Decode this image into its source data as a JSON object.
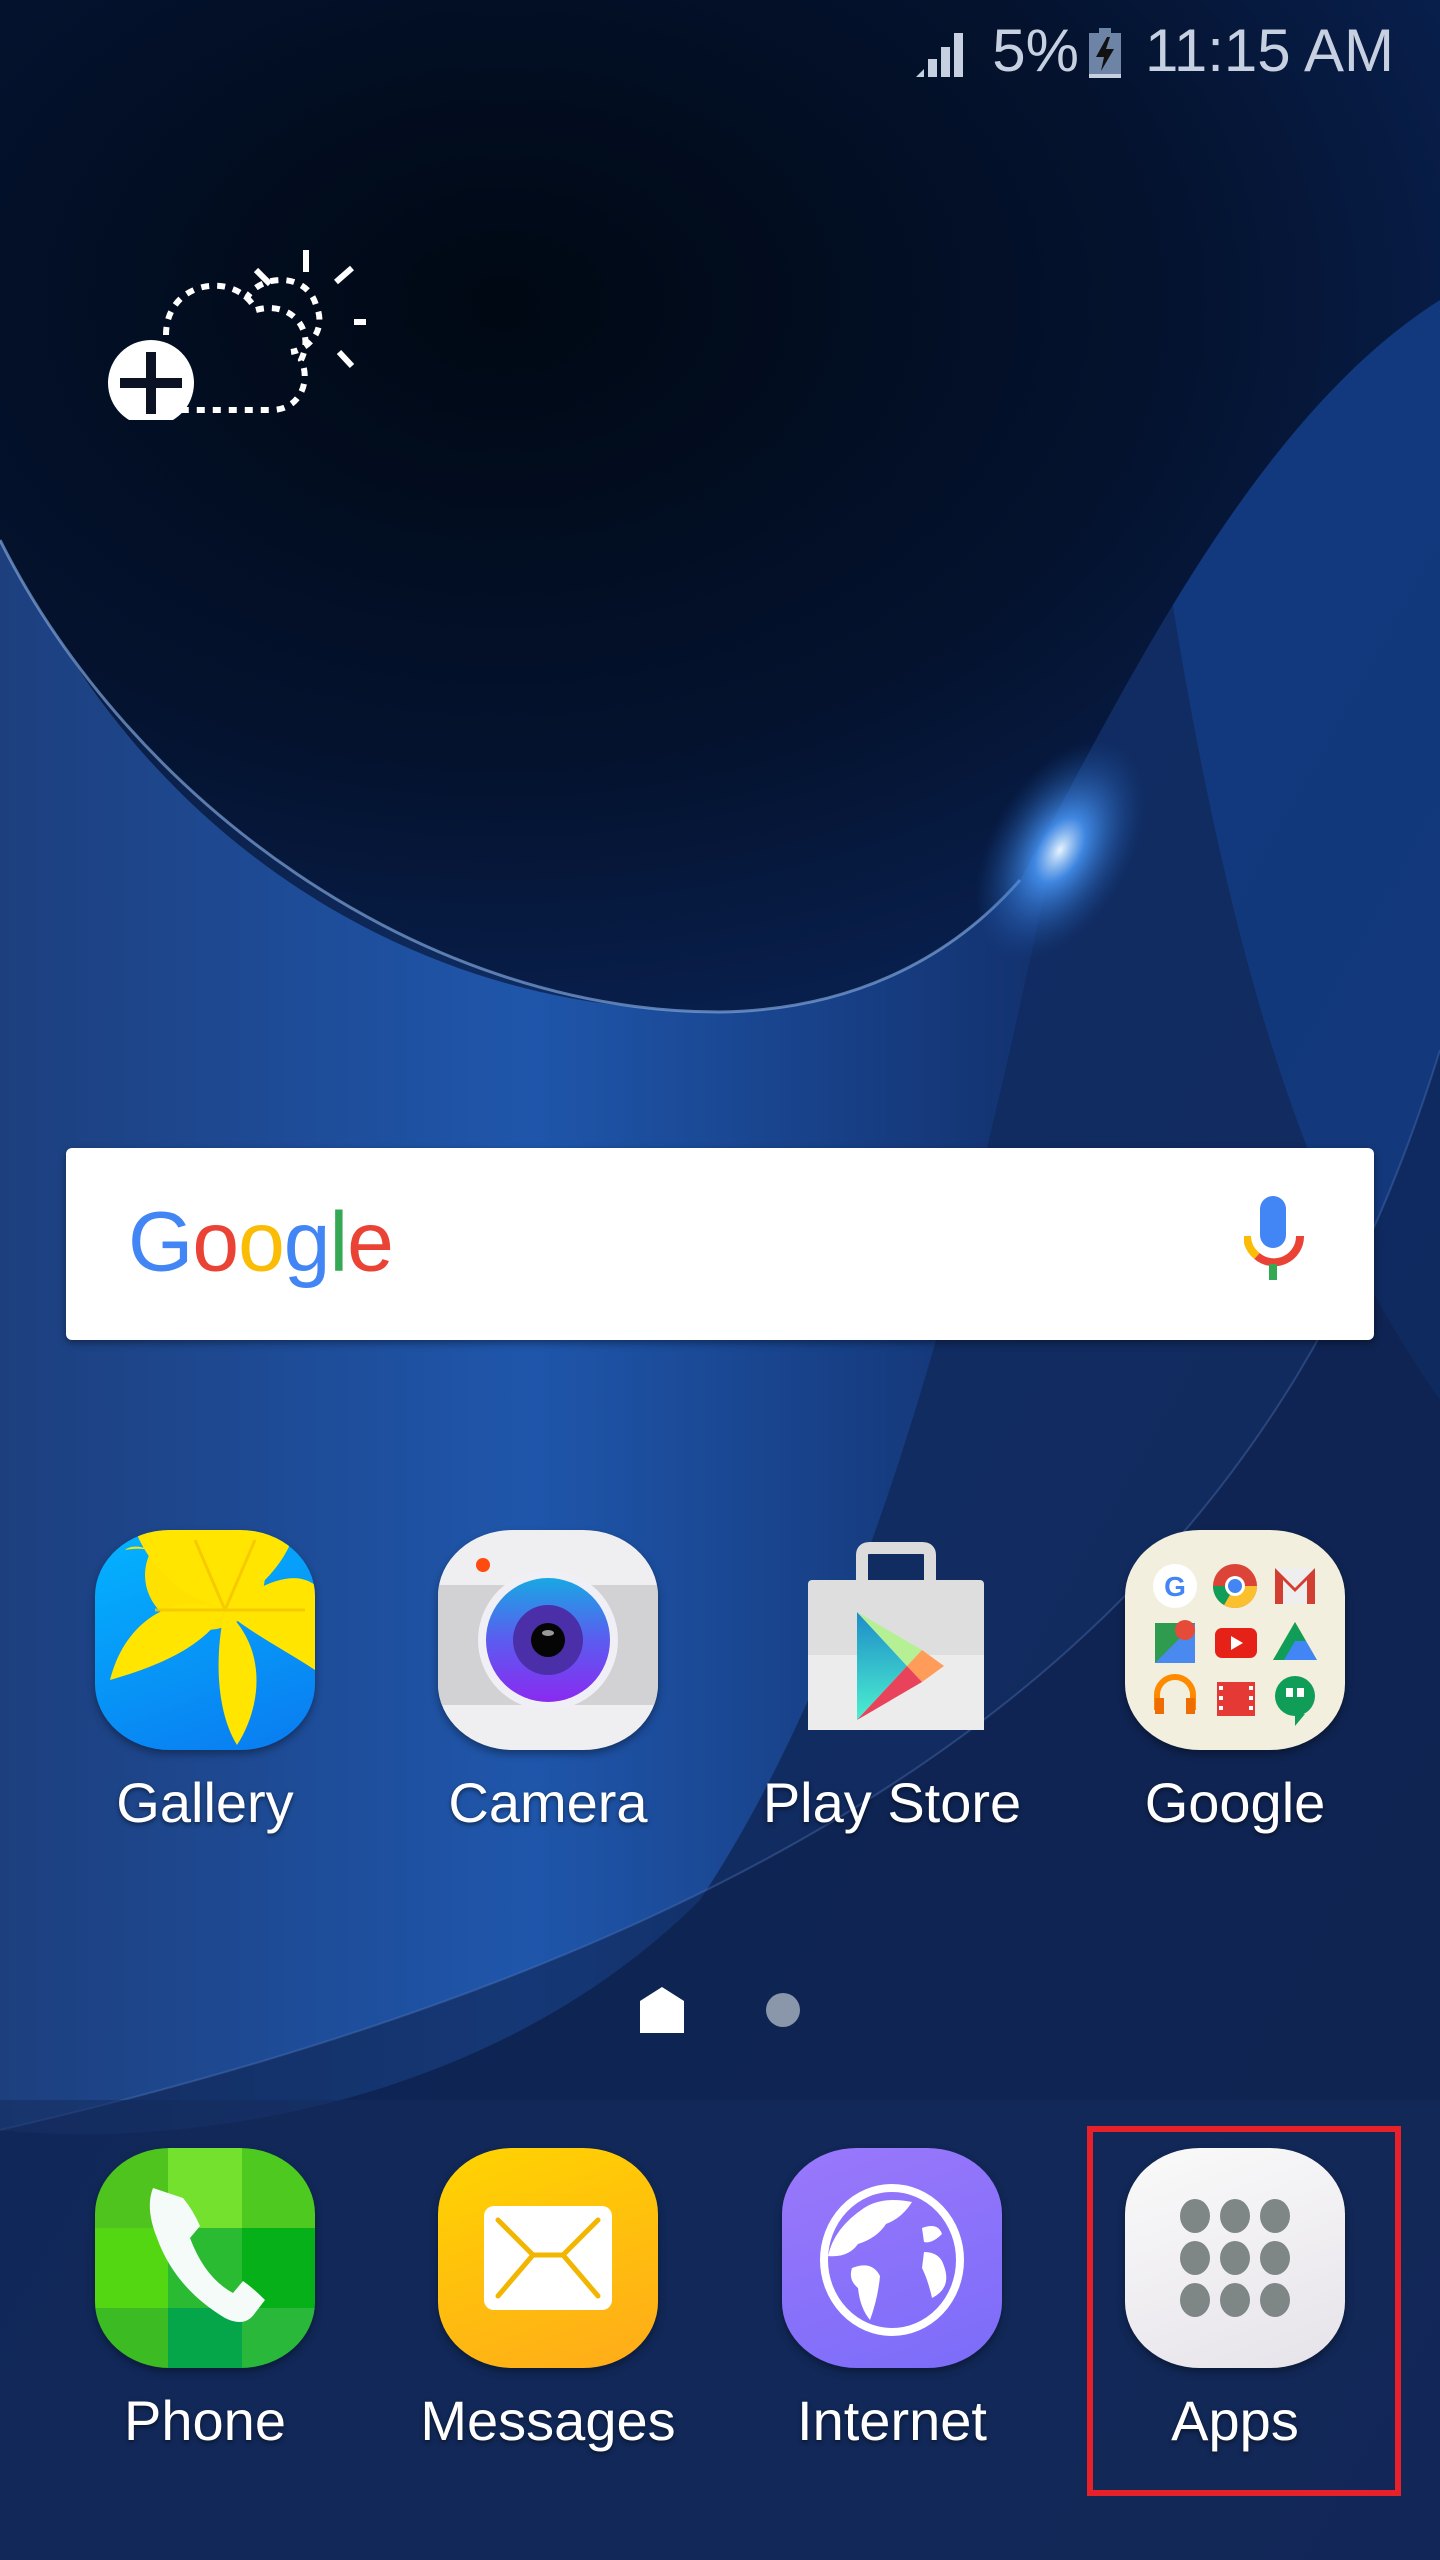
{
  "status_bar": {
    "signal_icon": "signal-bars-icon",
    "battery_percent": "5%",
    "battery_icon": "battery-charging-icon",
    "time": "11:15 AM"
  },
  "weather_widget": {
    "icon": "add-weather-icon",
    "description": "Add weather widget"
  },
  "search_bar": {
    "logo_letters": [
      "G",
      "o",
      "o",
      "g",
      "l",
      "e"
    ],
    "logo_colors": [
      "#4285F4",
      "#EA4335",
      "#FBBC05",
      "#4285F4",
      "#34A853",
      "#EA4335"
    ],
    "mic_icon": "voice-search-icon"
  },
  "home_apps": [
    {
      "label": "Gallery",
      "icon": "gallery-icon"
    },
    {
      "label": "Camera",
      "icon": "camera-icon"
    },
    {
      "label": "Play Store",
      "icon": "play-store-icon"
    },
    {
      "label": "Google",
      "icon": "google-folder-icon"
    }
  ],
  "page_indicator": {
    "pages": [
      "home",
      "page-2"
    ],
    "current": "home"
  },
  "dock_apps": [
    {
      "label": "Phone",
      "icon": "phone-icon"
    },
    {
      "label": "Messages",
      "icon": "messages-icon"
    },
    {
      "label": "Internet",
      "icon": "internet-icon"
    },
    {
      "label": "Apps",
      "icon": "apps-grid-icon",
      "highlighted": true
    }
  ],
  "colors": {
    "highlight": "#e8202a",
    "wallpaper_dark": "#020a1c",
    "wallpaper_blue": "#1c4f9e"
  }
}
